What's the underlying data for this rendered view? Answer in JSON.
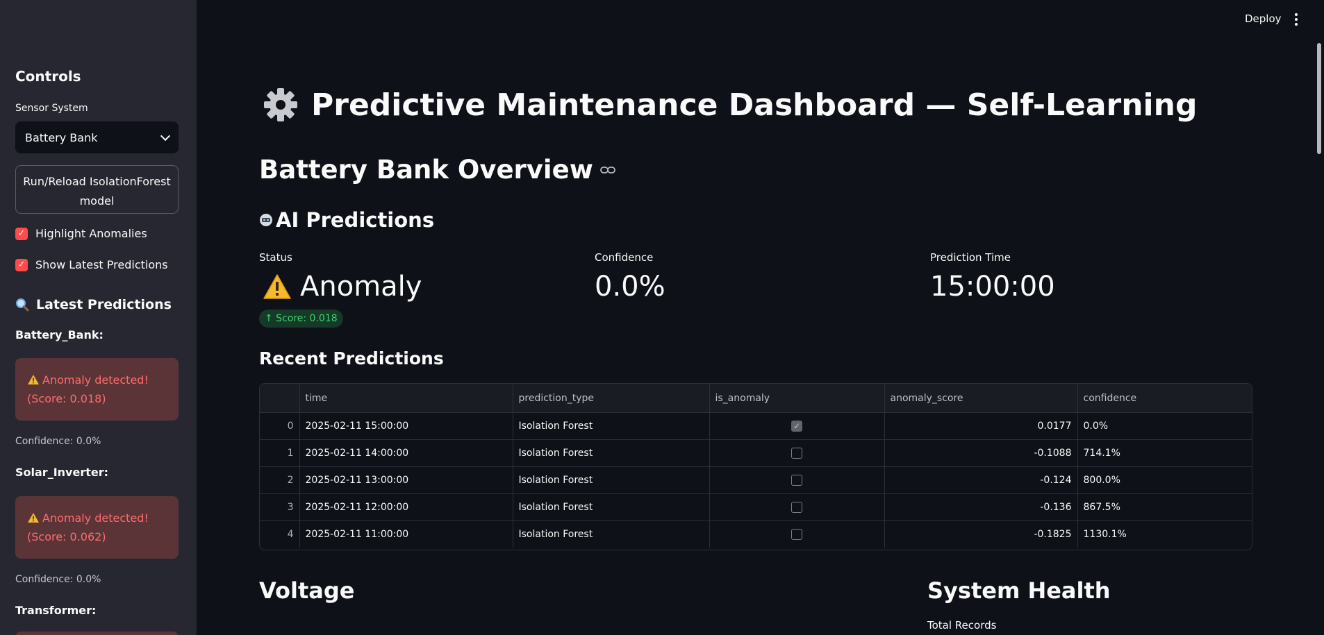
{
  "topbar": {
    "deploy_label": "Deploy"
  },
  "sidebar": {
    "title": "Controls",
    "sensor_label": "Sensor System",
    "sensor_value": "Battery Bank",
    "run_button": "Run/Reload IsolationForest model",
    "checkbox_highlight": "Highlight Anomalies",
    "checkbox_show_latest": "Show Latest Predictions",
    "latest_heading": "Latest Predictions",
    "systems": [
      {
        "name": "Battery_Bank:",
        "alert": "Anomaly detected! (Score: 0.018)",
        "confidence": "Confidence: 0.0%"
      },
      {
        "name": "Solar_Inverter:",
        "alert": "Anomaly detected! (Score: 0.062)",
        "confidence": "Confidence: 0.0%"
      },
      {
        "name": "Transformer:"
      }
    ]
  },
  "main": {
    "title": "Predictive Maintenance Dashboard — Self-Learning",
    "overview": "Battery Bank Overview",
    "ai_heading": "AI Predictions",
    "metrics": {
      "status_label": "Status",
      "status_value": "Anomaly",
      "score": "↑ Score: 0.018",
      "confidence_label": "Confidence",
      "confidence_value": "0.0%",
      "time_label": "Prediction Time",
      "time_value": "15:00:00"
    },
    "recent_heading": "Recent Predictions",
    "table": {
      "columns": [
        "",
        "time",
        "prediction_type",
        "is_anomaly",
        "anomaly_score",
        "confidence"
      ],
      "rows": [
        {
          "idx": "0",
          "time": "2025-02-11 15:00:00",
          "type": "Isolation Forest",
          "is_anomaly": true,
          "score": "0.0177",
          "confidence": "0.0%"
        },
        {
          "idx": "1",
          "time": "2025-02-11 14:00:00",
          "type": "Isolation Forest",
          "is_anomaly": false,
          "score": "-0.1088",
          "confidence": "714.1%"
        },
        {
          "idx": "2",
          "time": "2025-02-11 13:00:00",
          "type": "Isolation Forest",
          "is_anomaly": false,
          "score": "-0.124",
          "confidence": "800.0%"
        },
        {
          "idx": "3",
          "time": "2025-02-11 12:00:00",
          "type": "Isolation Forest",
          "is_anomaly": false,
          "score": "-0.136",
          "confidence": "867.5%"
        },
        {
          "idx": "4",
          "time": "2025-02-11 11:00:00",
          "type": "Isolation Forest",
          "is_anomaly": false,
          "score": "-0.1825",
          "confidence": "1130.1%"
        }
      ]
    },
    "voltage_heading": "Voltage",
    "health_heading": "System Health",
    "total_records_label": "Total Records"
  },
  "colors": {
    "accent": "#ff4b4b",
    "background": "#0e1117",
    "sidebar": "#262730",
    "alert_bg": "#5b3438",
    "alert_text": "#ff6c6c",
    "positive": "#3dd56d"
  },
  "icons": {
    "title": "gear-icon",
    "ai": "robot-icon",
    "status": "warning-icon",
    "latest": "magnifier-icon",
    "overview": "link-icon"
  }
}
